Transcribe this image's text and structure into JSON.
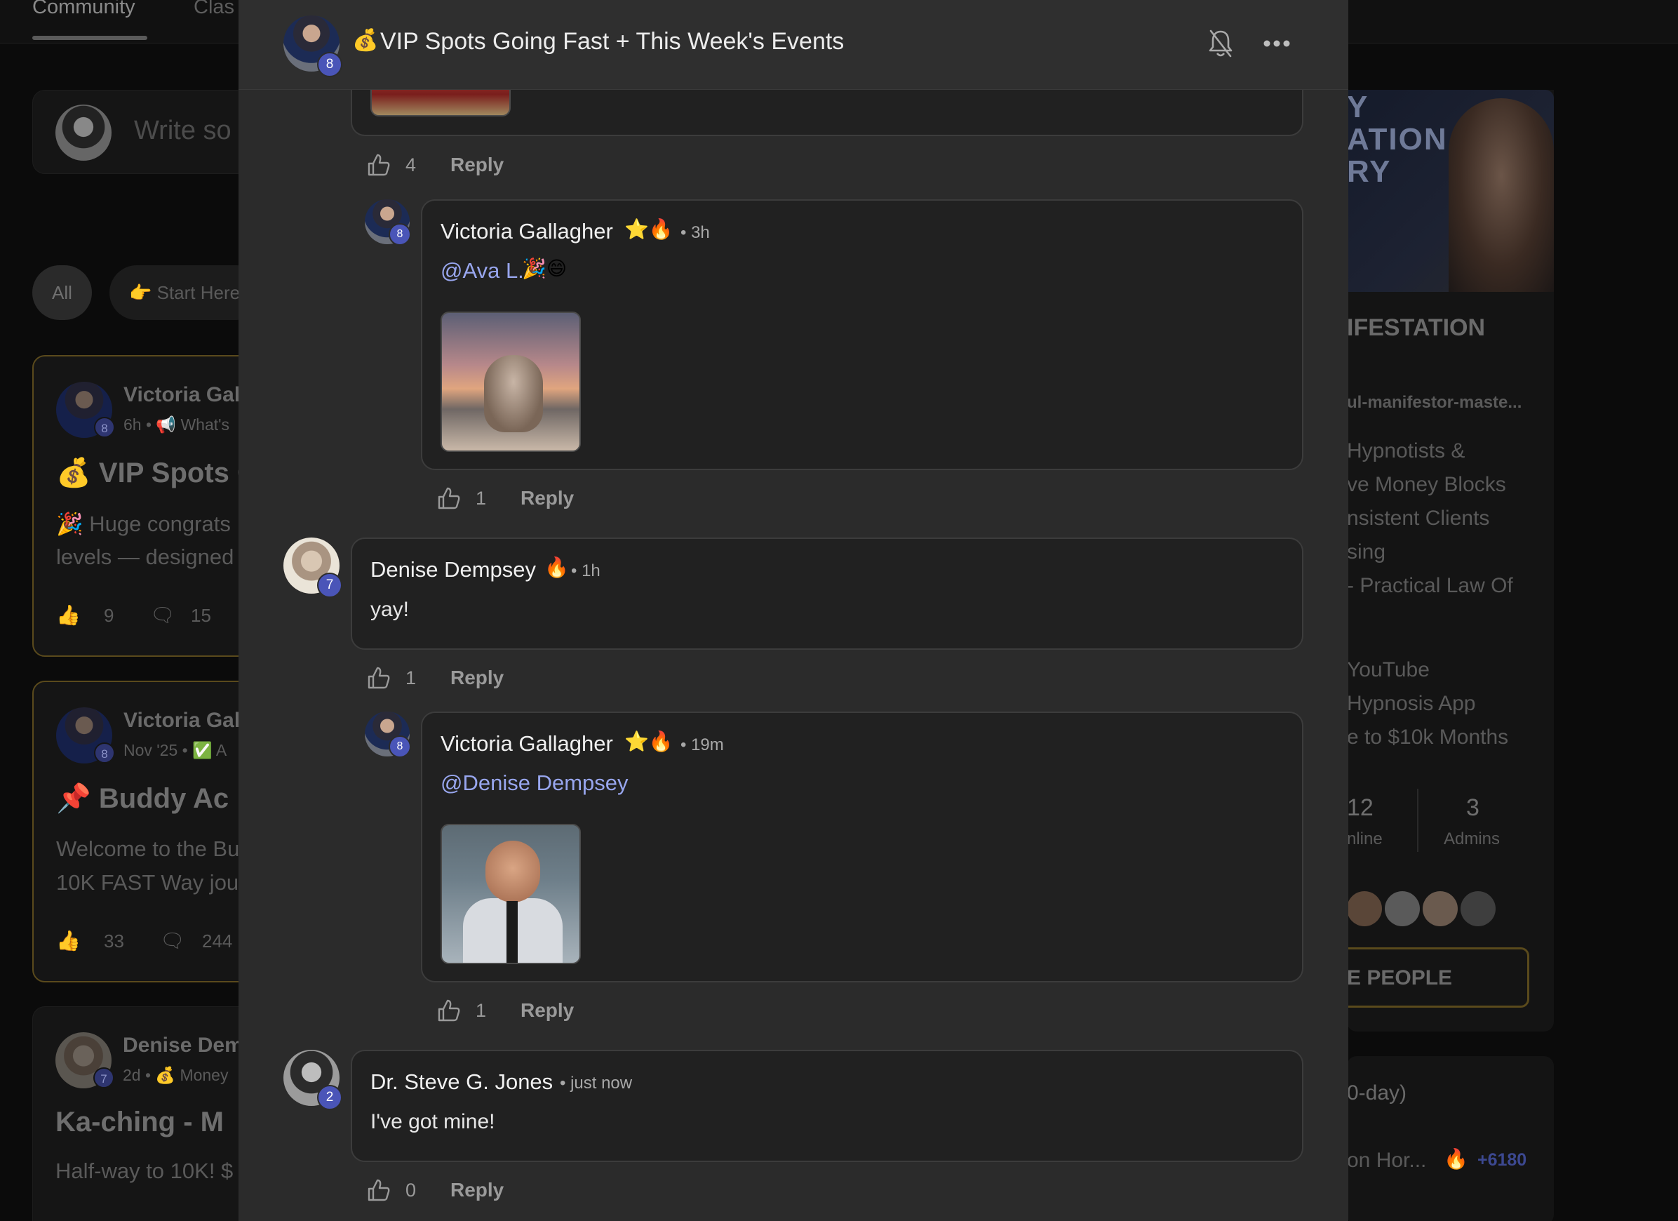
{
  "background": {
    "tabs": [
      {
        "label": "Community",
        "active": true
      },
      {
        "label": "Clas",
        "active": false
      }
    ],
    "composer_placeholder": "Write so",
    "filter_chips": [
      "All",
      "👉 Start Here"
    ],
    "posts": [
      {
        "author": "Victoria Gal",
        "level": "8",
        "meta": "6h • 📢 What's",
        "title": "💰 VIP Spots G",
        "excerpt": [
          "🎉 Huge congrats",
          "levels — designed"
        ],
        "likes": "9",
        "comments": "15"
      },
      {
        "author": "Victoria Gal",
        "level": "8",
        "meta": "Nov '25 • ✅ A",
        "title": "📌 Buddy Ac",
        "excerpt": [
          "Welcome to the Bu",
          "10K FAST Way jou"
        ],
        "likes": "33",
        "comments": "244"
      },
      {
        "author": "Denise Dem",
        "level": "7",
        "meta": "2d • 💰 Money",
        "title": "Ka-ching - M",
        "excerpt": [
          "Half-way to 10K! $"
        ]
      }
    ],
    "right": {
      "banner_words": [
        "Y",
        "ATION",
        "RY"
      ],
      "group_name": "IFESTATION",
      "url": "ul-manifestor-maste...",
      "description": [
        "Hypnotists &",
        "ve Money Blocks",
        "nsistent Clients",
        "sing",
        "- Practical Law Of"
      ],
      "links": [
        "YouTube",
        "Hypnosis App",
        "e to $10k Months"
      ],
      "stats": [
        {
          "value": "12",
          "label": "nline"
        },
        {
          "value": "3",
          "label": "Admins"
        }
      ],
      "invite_label": "E PEOPLE",
      "leaderboard_title": "0-day)",
      "leader_name": "on Hor...",
      "leader_points": "+6180"
    }
  },
  "modal": {
    "title_emoji": "💰",
    "title": "VIP Spots Going Fast + This Week's Events",
    "author_level": "8",
    "comments": [
      {
        "type": "actions",
        "likes": "4",
        "reply_label": "Reply"
      },
      {
        "author": "Victoria Gallagher",
        "badges": "⭐🔥",
        "time": "• 3h",
        "level": "8",
        "mention": "@Ava L.",
        "text_emoji": "🎉😄",
        "gif": "dancing-seal",
        "likes": "1",
        "reply_label": "Reply"
      },
      {
        "author": "Denise Dempsey",
        "badges": "🔥",
        "time": "• 1h",
        "level": "7",
        "text": "yay!",
        "likes": "1",
        "reply_label": "Reply"
      },
      {
        "author": "Victoria Gallagher",
        "badges": "⭐🔥",
        "time": "• 19m",
        "level": "8",
        "mention": "@Denise Dempsey",
        "gif": "excited-man",
        "likes": "1",
        "reply_label": "Reply"
      },
      {
        "author": "Dr. Steve G. Jones",
        "time": "• just now",
        "level": "2",
        "text": "I've got mine!",
        "likes": "0",
        "reply_label": "Reply"
      }
    ]
  },
  "colors": {
    "modal_bg": "#2b2b2b",
    "bubble_bg": "#212121",
    "level_badge": "#4a55b8",
    "mention": "#98a6ee",
    "gold_border": "#5a4a1c"
  },
  "icons": [
    "bell-off-icon",
    "more-icon",
    "thumbs-up-icon"
  ]
}
